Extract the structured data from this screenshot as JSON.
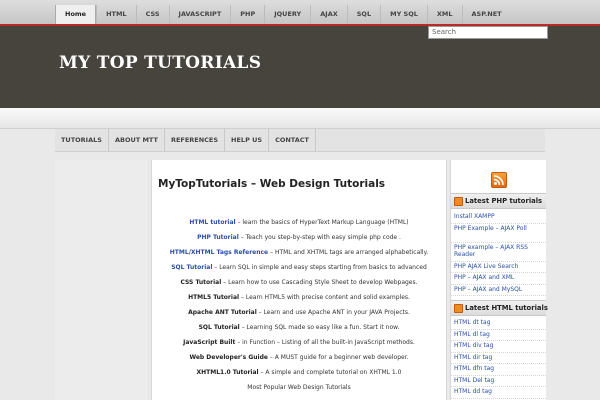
{
  "top_nav": {
    "items": [
      "Home",
      "HTML",
      "CSS",
      "JAVASCRIPT",
      "PHP",
      "JQUERY",
      "AJAX",
      "SQL",
      "MY SQL",
      "XML",
      "ASP.NET"
    ],
    "active": "Home"
  },
  "header": {
    "site_title": "MY TOP TUTORIALS",
    "search_placeholder": "Search"
  },
  "main_nav": {
    "items": [
      "TUTORIALS",
      "ABOUT MTT",
      "REFERENCES",
      "HELP US",
      "CONTACT"
    ]
  },
  "content": {
    "title": "MyTopTutorials – Web Design Tutorials",
    "tutorials": [
      {
        "name": "HTML tutorial",
        "style": "link",
        "desc": " – learn the basics of HyperText Markup Language (HTML)"
      },
      {
        "name": "PHP Tutorial",
        "style": "link",
        "desc": " – Teach you step-by-step with easy simple php code ."
      },
      {
        "name": "HTML/XHTML Tags Reference",
        "style": "link",
        "desc": " – HTML and XHTML tags are arranged alphabetically."
      },
      {
        "name": "SQL Tutorial",
        "style": "link",
        "desc": " – Learn SQL in simple and easy steps starting from basics to advanced"
      },
      {
        "name": "CSS Tutorial",
        "style": "bold",
        "desc": " – Learn how to use Cascading Style Sheet to develop Webpages."
      },
      {
        "name": "HTML5 Tutorial",
        "style": "bold",
        "desc": " – Learn HTML5 with precise content and solid examples."
      },
      {
        "name": "Apache ANT Tutorial",
        "style": "bold",
        "desc": " – Learn and use Apache ANT in your JAVA Projects."
      },
      {
        "name": "SQL Tutorial",
        "style": "bold",
        "desc": " – Learning SQL made so easy like a fun. Start it now."
      },
      {
        "name": "JavaScript Built",
        "style": "bold",
        "desc": " – in Function – Listing of all the built-in JavaScript methods."
      },
      {
        "name": "Web Developer's Guide",
        "style": "bold",
        "desc": " – A MUST guide for a beginner web developer."
      },
      {
        "name": "XHTML1.0 Tutorial",
        "style": "bold",
        "desc": " – A simple and complete tutorial on XHTML 1.0"
      },
      {
        "name": "",
        "style": "plain",
        "desc": "Most Popular Web Design Tutorials"
      }
    ]
  },
  "sidebar": {
    "php_heading": "Latest PHP tutorials",
    "php_links": [
      "Install XAMPP",
      "PHP Example – AJAX Poll",
      "PHP example – AJAX RSS Reader",
      "PHP AJAX Live Search",
      "PHP – AJAX and XML",
      "PHP – AJAX and MySQL"
    ],
    "html_heading": "Latest HTML tutorials",
    "html_links": [
      "HTML dt tag",
      "HTML dl tag",
      "HTML div tag",
      "HTML dir tag",
      "HTML dfn tag",
      "HTML Del tag",
      "HTML dd tag"
    ]
  }
}
